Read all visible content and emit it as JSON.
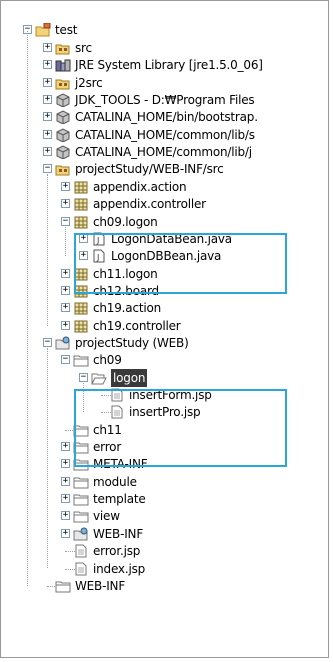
{
  "tree": {
    "root": "test",
    "items": [
      {
        "label": "src",
        "icon": "source-folder-icon",
        "toggle": "+"
      },
      {
        "label": "JRE System Library [jre1.5.0_06]",
        "icon": "library-icon",
        "toggle": "+"
      },
      {
        "label": "j2src",
        "icon": "source-folder-icon",
        "toggle": "+"
      },
      {
        "label": "JDK_TOOLS - D:₩Program Files",
        "icon": "jar-icon",
        "toggle": "+"
      },
      {
        "label": "CATALINA_HOME/bin/bootstrap.",
        "icon": "jar-icon",
        "toggle": "+"
      },
      {
        "label": "CATALINA_HOME/common/lib/s",
        "icon": "jar-icon",
        "toggle": "+"
      },
      {
        "label": "CATALINA_HOME/common/lib/j",
        "icon": "jar-icon",
        "toggle": "+"
      },
      {
        "label": "projectStudy/WEB-INF/src",
        "icon": "source-folder-icon",
        "toggle": "-"
      },
      {
        "label": "appendix.action",
        "icon": "package-icon",
        "toggle": "+"
      },
      {
        "label": "appendix.controller",
        "icon": "package-icon",
        "toggle": "+"
      },
      {
        "label": "ch09.logon",
        "icon": "package-icon",
        "toggle": "-"
      },
      {
        "label": "LogonDataBean.java",
        "icon": "java-file-icon",
        "toggle": "+"
      },
      {
        "label": "LogonDBBean.java",
        "icon": "java-file-icon",
        "toggle": "+"
      },
      {
        "label": "ch11.logon",
        "icon": "package-icon",
        "toggle": "+"
      },
      {
        "label": "ch12.board",
        "icon": "package-icon",
        "toggle": "+"
      },
      {
        "label": "ch19.action",
        "icon": "package-icon",
        "toggle": "+"
      },
      {
        "label": "ch19.controller",
        "icon": "package-icon",
        "toggle": "+"
      },
      {
        "label": "projectStudy (WEB)",
        "icon": "web-folder-icon",
        "toggle": "-"
      },
      {
        "label": "ch09",
        "icon": "folder-icon",
        "toggle": "-"
      },
      {
        "label": "logon",
        "icon": "folder-open-icon",
        "toggle": "-"
      },
      {
        "label": "insertForm.jsp",
        "icon": "file-icon",
        "toggle": ""
      },
      {
        "label": "insertPro.jsp",
        "icon": "file-icon",
        "toggle": ""
      },
      {
        "label": "ch11",
        "icon": "folder-icon",
        "toggle": ""
      },
      {
        "label": "error",
        "icon": "folder-icon",
        "toggle": "+"
      },
      {
        "label": "META-INF",
        "icon": "folder-icon",
        "toggle": "+"
      },
      {
        "label": "module",
        "icon": "folder-icon",
        "toggle": "+"
      },
      {
        "label": "template",
        "icon": "folder-icon",
        "toggle": "+"
      },
      {
        "label": "view",
        "icon": "folder-icon",
        "toggle": "+"
      },
      {
        "label": "WEB-INF",
        "icon": "web-folder-icon",
        "toggle": "+"
      },
      {
        "label": "error.jsp",
        "icon": "file-icon",
        "toggle": ""
      },
      {
        "label": "index.jsp",
        "icon": "file-icon",
        "toggle": ""
      },
      {
        "label": "WEB-INF",
        "icon": "folder-icon",
        "toggle": ""
      }
    ]
  },
  "colors": {
    "highlight_border": "#2aa6d8",
    "selection_bg": "#3a3a3a"
  }
}
